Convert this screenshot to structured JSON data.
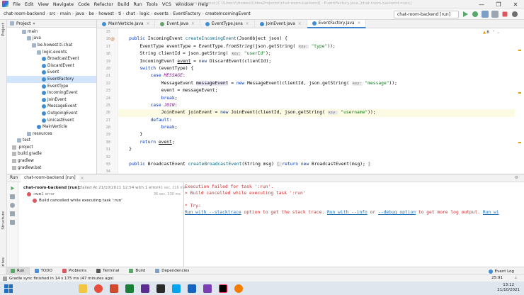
{
  "menu": [
    "File",
    "Edit",
    "View",
    "Navigate",
    "Code",
    "Refactor",
    "Build",
    "Run",
    "Tools",
    "VCS",
    "Window",
    "Help"
  ],
  "window_title": "chat-room-backend [C:\\\\Users\\\\howest\\\\IdeaProjects\\\\chat-room-backend] - EventFactory.java [chat-room-backend.main]",
  "window_controls": [
    "—",
    "❐",
    "✕"
  ],
  "breadcrumbs": [
    "chat-room-backend",
    "src",
    "main",
    "java",
    "be",
    "howest",
    "ti",
    "chat",
    "logic",
    "events",
    "EventFactory",
    "createIncomingEvent"
  ],
  "run_config": "chat-room-backend [run]",
  "project_panel": {
    "title": "Project",
    "tree": [
      {
        "label": "main",
        "depth": 3,
        "icon": "folder"
      },
      {
        "label": "java",
        "depth": 4,
        "icon": "folder"
      },
      {
        "label": "be.howest.ti.chat",
        "depth": 5,
        "icon": "folder"
      },
      {
        "label": "logic.events",
        "depth": 6,
        "icon": "folder"
      },
      {
        "label": "BroadcastEvent",
        "depth": 7,
        "icon": "class"
      },
      {
        "label": "DiscardEvent",
        "depth": 7,
        "icon": "class"
      },
      {
        "label": "Event",
        "depth": 7,
        "icon": "class"
      },
      {
        "label": "EventFactory",
        "depth": 7,
        "icon": "class",
        "selected": true
      },
      {
        "label": "EventType",
        "depth": 7,
        "icon": "class"
      },
      {
        "label": "IncomingEvent",
        "depth": 7,
        "icon": "class"
      },
      {
        "label": "JoinEvent",
        "depth": 7,
        "icon": "class"
      },
      {
        "label": "MessageEvent",
        "depth": 7,
        "icon": "class"
      },
      {
        "label": "OutgoingEvent",
        "depth": 7,
        "icon": "class"
      },
      {
        "label": "UnicastEvent",
        "depth": 7,
        "icon": "class"
      },
      {
        "label": "MainVerticle",
        "depth": 6,
        "icon": "class"
      },
      {
        "label": "resources",
        "depth": 4,
        "icon": "folder"
      },
      {
        "label": "test",
        "depth": 2,
        "icon": "folder"
      },
      {
        "label": ".project",
        "depth": 1,
        "icon": "file"
      },
      {
        "label": "build.gradle",
        "depth": 1,
        "icon": "file"
      },
      {
        "label": "gradlew",
        "depth": 1,
        "icon": "file"
      },
      {
        "label": "gradlew.bat",
        "depth": 1,
        "icon": "file"
      }
    ]
  },
  "editor_tabs": [
    {
      "label": "MainVerticle.java",
      "color": "#3d8ed6"
    },
    {
      "label": "Event.java",
      "color": "#67a26a"
    },
    {
      "label": "EventType.java",
      "color": "#3d8ed6"
    },
    {
      "label": "JoinEvent.java",
      "color": "#3d8ed6"
    },
    {
      "label": "EventFactory.java",
      "color": "#3d8ed6",
      "active": true
    }
  ],
  "warning_count": "8",
  "line_numbers": [
    "15",
    "16",
    "17",
    "18",
    "19",
    "20",
    "21",
    "22",
    "23",
    "24",
    "25",
    "26",
    "27",
    "28",
    "29",
    "30",
    "31",
    "32",
    "33",
    "34"
  ],
  "run_panel": {
    "tab": "chat-room-backend [run]",
    "tree": [
      {
        "status": "failed",
        "label": "chat-room-backend [run]:",
        "detail": " failed At 21/10/2021 12:54 with 1 error",
        "time": "41 sec, 216 ms"
      },
      {
        "status": "failed",
        "label": ":run",
        "detail": "  1 error",
        "time": "36 sec, 330 ms"
      },
      {
        "status": "error",
        "label": "Build cancelled while executing task ':run'",
        "detail": "",
        "time": ""
      }
    ],
    "console": {
      "line1": "Execution failed for task ':run'.",
      "line2": "> Build cancelled while executing task ':run'",
      "line3": "* Try:",
      "link1": "Run with --stacktrace",
      "mid1": " option to get the stack trace. ",
      "link2": "Run with --info",
      "mid2": " or ",
      "link3": "--debug option",
      "mid3": " to get more log output. ",
      "link4": "Run wi"
    }
  },
  "left_stripe": [
    "Project",
    "Structure",
    "Favorites"
  ],
  "tool_tabs": [
    "Run",
    "TODO",
    "Problems",
    "Terminal",
    "Build",
    "Dependencies"
  ],
  "event_log": "Event Log",
  "status": {
    "message": "Gradle sync finished in 14 s 175 ms (47 minutes ago)",
    "position": "25:91"
  },
  "taskbar": {
    "time": "13:12",
    "date": "21/10/2021"
  }
}
